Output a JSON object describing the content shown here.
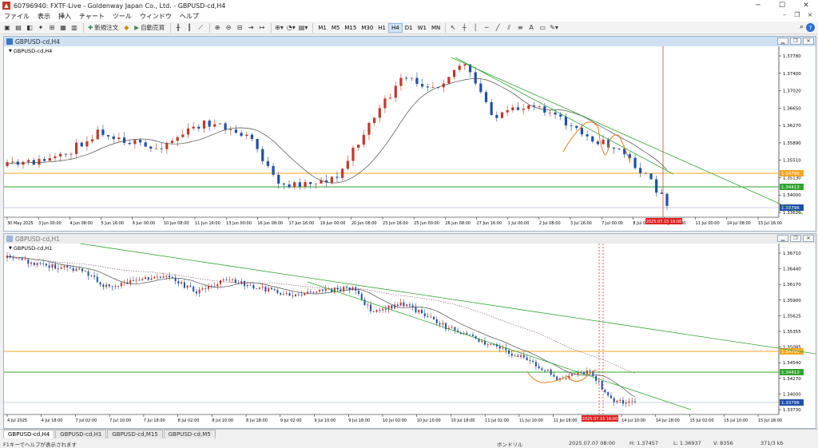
{
  "window": {
    "title": "60796940: FXTF-Live - Goldenway Japan Co., Ltd. - GBPUSD-cd,H4",
    "minimize": "─",
    "maximize": "☐",
    "close": "✕"
  },
  "menu": [
    "ファイル",
    "表示",
    "挿入",
    "チャート",
    "ツール",
    "ウィンドウ",
    "ヘルプ"
  ],
  "toolbar": {
    "new_order": "新規注文",
    "auto_trading": "自動売買",
    "timeframes": [
      "M1",
      "M5",
      "M15",
      "M30",
      "H1",
      "H4",
      "D1",
      "W1",
      "MN"
    ],
    "active_timeframe": "H4"
  },
  "chart_windows": [
    {
      "title": "GBPUSD-cd,H4",
      "symbol_label": "GBPUSD-cd,H4",
      "price_axis": [
        "1.37780",
        "1.37400",
        "1.37020",
        "1.36650",
        "1.36270",
        "1.35890",
        "1.35510",
        "1.35130",
        "1.34790",
        "1.34413",
        "1.34000",
        "1.33796",
        "1.33620"
      ],
      "time_axis": [
        "30 May 2025",
        "3 Jun 00:00",
        "4 Jun 08:00",
        "5 Jun 16:00",
        "9 Jun 00:00",
        "10 Jun 08:00",
        "11 Jun 16:00",
        "13 Jun 00:00",
        "16 Jun 08:00",
        "17 Jun 16:00",
        "19 Jun 00:00",
        "20 Jun 08:00",
        "23 Jun 16:00",
        "25 Jun 00:00",
        "26 Jun 08:00",
        "27 Jun 16:00",
        "1 Jul 00:00",
        "2 Jul 08:00",
        "3 Jul 16:00",
        "7 Jul 00:00",
        "8 Jul 08:00",
        "9 Jul 16:00",
        "11 Jul 00:00",
        "14 Jul 08:00",
        "15 Jul 16:00"
      ],
      "cursor_time_label": "2025.07.15 16:00",
      "price_marker_orange": "1.34790",
      "price_marker_green": "1.34413",
      "price_marker_current": "1.33796"
    },
    {
      "title": "GBPUSD-cd,H1",
      "symbol_label": "GBPUSD-cd,H1",
      "price_axis": [
        "1.36710",
        "1.36440",
        "1.36170",
        "1.35900",
        "1.35625",
        "1.35355",
        "1.35085",
        "1.34790",
        "1.34540",
        "1.34413",
        "1.34270",
        "1.34000",
        "1.33796",
        "1.33730"
      ],
      "time_axis": [
        "4 Jul 2025",
        "4 Jul 18:00",
        "7 Jul 02:00",
        "7 Jul 10:00",
        "7 Jul 18:00",
        "8 Jul 02:00",
        "8 Jul 10:00",
        "8 Jul 18:00",
        "9 Jul 02:00",
        "9 Jul 10:00",
        "9 Jul 18:00",
        "10 Jul 02:00",
        "10 Jul 10:00",
        "10 Jul 18:00",
        "11 Jul 02:00",
        "11 Jul 10:00",
        "11 Jul 18:00",
        "14 Jul 02:00",
        "14 Jul 10:00",
        "14 Jul 18:00",
        "15 Jul 02:00",
        "15 Jul 10:00",
        "15 Jul 18:00"
      ],
      "cursor_time_label": "2025.07.15 16:00",
      "price_marker_orange": "1.34790",
      "price_marker_green": "1.34413",
      "price_marker_current": "1.33796"
    }
  ],
  "tabs": [
    "GBPUSD-cd,H4",
    "GBPUSD-cd,H1",
    "GBPUSD-cd,M15",
    "GBPUSD-cd,M5"
  ],
  "active_tab": "GBPUSD-cd,H4",
  "status": {
    "help": "F1キーでヘルプが表示されます",
    "profile": "ボンドリル",
    "datetime": "2025.07.07 08:00",
    "high": "H: 1.37457",
    "low": "L: 1.36937",
    "volume": "V: 8356",
    "traffic": "371/3 kb"
  },
  "colors": {
    "bull_candle": "#c0392b",
    "bear_candle": "#1f4fa8",
    "ma_line": "#4a4a4a",
    "trend_line": "#2fa52f",
    "orange_level": "#f5a623",
    "green_level": "#2fa52f",
    "cursor_line": "#e02020",
    "annotation": "#e67e22"
  }
}
